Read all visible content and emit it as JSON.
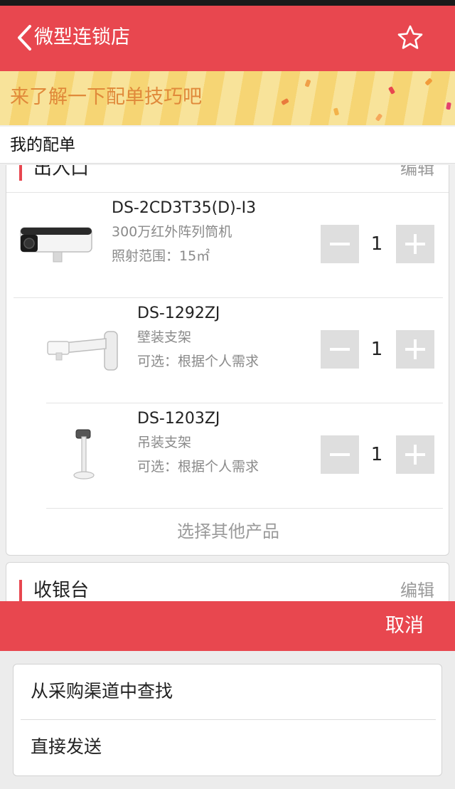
{
  "header": {
    "title": "微型连锁店"
  },
  "banner": {
    "text": "来了解一下配单技巧吧"
  },
  "my_order": {
    "label": "我的配单"
  },
  "section1": {
    "title": "出入口",
    "edit_label": "编辑",
    "items": [
      {
        "name": "DS-2CD3T35(D)-I3",
        "desc": "300万红外阵列筒机",
        "note": "照射范围：15㎡",
        "qty": "1",
        "image": "bullet-camera-image"
      },
      {
        "name": "DS-1292ZJ",
        "desc": "壁装支架",
        "note": "可选：根据个人需求",
        "qty": "1",
        "image": "wall-mount-bracket-image"
      },
      {
        "name": "DS-1203ZJ",
        "desc": "吊装支架",
        "note": "可选：根据个人需求",
        "qty": "1",
        "image": "ceiling-mount-bracket-image"
      }
    ],
    "choose_other_label": "选择其他产品"
  },
  "section2": {
    "title": "收银台",
    "edit_label": "编辑"
  },
  "action_sheet": {
    "cancel_label": "取消",
    "options": [
      "从采购渠道中查找",
      "直接发送"
    ]
  },
  "colors": {
    "accent": "#e8474f",
    "banner_text": "#e0893a",
    "muted": "#9a9a9a"
  }
}
